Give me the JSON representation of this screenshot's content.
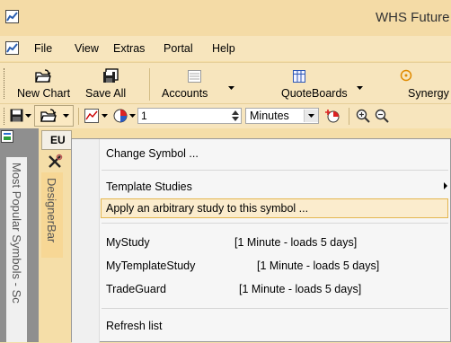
{
  "window": {
    "title": "WHS Future"
  },
  "menubar": {
    "items": [
      "File",
      "View",
      "Extras",
      "Portal",
      "Help"
    ]
  },
  "toolbar": {
    "buttons": [
      {
        "label": "New Chart",
        "icon": "open-folder-icon"
      },
      {
        "label": "Save All",
        "icon": "save-all-icon"
      },
      {
        "label": "Accounts",
        "icon": "accounts-icon"
      },
      {
        "label": "QuoteBoards",
        "icon": "quoteboard-icon"
      },
      {
        "label": "Synergy",
        "icon": "synergy-icon"
      }
    ]
  },
  "chart_toolbar": {
    "interval_value": "1",
    "interval_unit": "Minutes"
  },
  "left_panel": {
    "tab_short": "EU",
    "vertical_tab_most": "Most Popular Symbols - Sc",
    "vertical_tab_designer": "DesignerBar"
  },
  "context_menu": {
    "change_symbol": "Change Symbol ...",
    "template_studies": "Template Studies",
    "apply_arbitrary": "Apply an arbitrary study to this symbol ...",
    "studies": [
      {
        "name": "MyStudy",
        "detail": "[1 Minute - loads 5 days]"
      },
      {
        "name": "MyTemplateStudy",
        "detail": "[1 Minute - loads 5 days]"
      },
      {
        "name": "TradeGuard",
        "detail": "[1 Minute - loads 5 days]"
      }
    ],
    "refresh": "Refresh list"
  }
}
